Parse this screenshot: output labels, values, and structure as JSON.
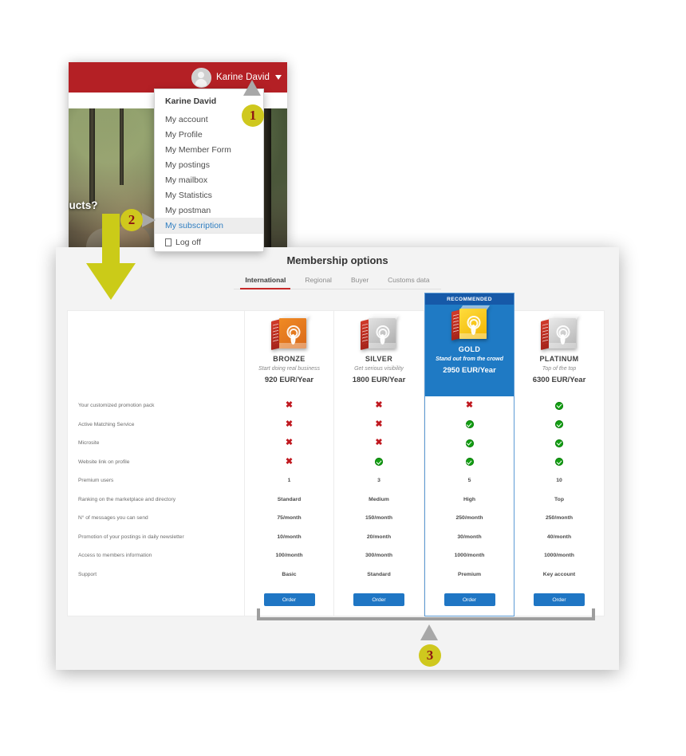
{
  "header": {
    "user_name": "Karine David",
    "avatar_icon": "user-avatar-icon",
    "caret_icon": "chevron-down-icon"
  },
  "hero": {
    "headline": "oducts?",
    "search_placeholder": "",
    "search_value": "",
    "search_icon": "search-icon"
  },
  "dropdown": {
    "title": "Karine David",
    "items": [
      {
        "label": "My account",
        "active": false
      },
      {
        "label": "My Profile",
        "active": false
      },
      {
        "label": "My Member Form",
        "active": false
      },
      {
        "label": "My postings",
        "active": false
      },
      {
        "label": "My mailbox",
        "active": false
      },
      {
        "label": "My Statistics",
        "active": false
      },
      {
        "label": "My postman",
        "active": false
      },
      {
        "label": "My subscription",
        "active": true
      }
    ],
    "logoff_label": "Log off",
    "logoff_icon": "logout-icon"
  },
  "panel": {
    "title": "Membership options",
    "tabs": [
      {
        "label": "International",
        "active": true
      },
      {
        "label": "Regional",
        "active": false
      },
      {
        "label": "Buyer",
        "active": false
      },
      {
        "label": "Customs data",
        "active": false
      }
    ],
    "plans": [
      {
        "name": "BRONZE",
        "tagline": "Start doing real business",
        "price": "920 EUR/Year",
        "badge": "",
        "recommended": false,
        "order_label": "Order",
        "box_icon": "bronze-box-icon"
      },
      {
        "name": "SILVER",
        "tagline": "Get serious visibility",
        "price": "1800 EUR/Year",
        "badge": "",
        "recommended": false,
        "order_label": "Order",
        "box_icon": "silver-box-icon"
      },
      {
        "name": "GOLD",
        "tagline": "Stand out from the crowd",
        "price": "2950 EUR/Year",
        "badge": "RECOMMENDED",
        "recommended": true,
        "order_label": "Order",
        "box_icon": "gold-box-icon"
      },
      {
        "name": "PLATINUM",
        "tagline": "Top of the top",
        "price": "6300 EUR/Year",
        "badge": "",
        "recommended": false,
        "order_label": "Order",
        "box_icon": "platinum-box-icon"
      }
    ],
    "features": [
      {
        "label": "Your customized promotion pack",
        "values": [
          "no",
          "no",
          "no",
          "yes"
        ]
      },
      {
        "label": "Active Matching Service",
        "values": [
          "no",
          "no",
          "yes",
          "yes"
        ]
      },
      {
        "label": "Microsite",
        "values": [
          "no",
          "no",
          "yes",
          "yes"
        ]
      },
      {
        "label": "Website link on profile",
        "values": [
          "no",
          "yes",
          "yes",
          "yes"
        ]
      },
      {
        "label": "Premium users",
        "values": [
          "1",
          "3",
          "5",
          "10"
        ]
      },
      {
        "label": "Ranking on the marketplace and directory",
        "values": [
          "Standard",
          "Medium",
          "High",
          "Top"
        ]
      },
      {
        "label": "N° of messages you can send",
        "values": [
          "75/month",
          "150/month",
          "250/month",
          "250/month"
        ]
      },
      {
        "label": "Promotion of your postings in daily newsletter",
        "values": [
          "10/month",
          "20/month",
          "30/month",
          "40/month"
        ]
      },
      {
        "label": "Access to members information",
        "values": [
          "100/month",
          "300/month",
          "1000/month",
          "1000/month"
        ]
      },
      {
        "label": "Support",
        "values": [
          "Basic",
          "Standard",
          "Premium",
          "Key account"
        ]
      }
    ]
  },
  "callouts": [
    {
      "number": "1"
    },
    {
      "number": "2"
    },
    {
      "number": "3"
    }
  ],
  "colors": {
    "brand_red": "#b42025",
    "accent_blue": "#1f76c4",
    "recommended_blue": "#1659a8",
    "callout_yellow": "#cfc81e",
    "callout_number_red": "#8e1414",
    "check_green": "#13a013",
    "cross_red": "#c0181f",
    "tab_underline_red": "#c62828",
    "arrow_yellow": "#cbcb18"
  }
}
